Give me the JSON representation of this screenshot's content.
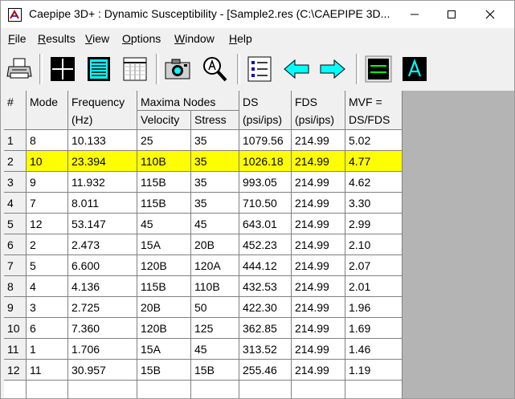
{
  "window": {
    "title": "Caepipe 3D+ : Dynamic Susceptibility -  [Sample2.res (C:\\CAEPIPE 3D..."
  },
  "menu": [
    {
      "u": "F",
      "rest": "ile"
    },
    {
      "u": "R",
      "rest": "esults"
    },
    {
      "u": "V",
      "rest": "iew"
    },
    {
      "u": "O",
      "rest": "ptions"
    },
    {
      "u": "W",
      "rest": "indow"
    },
    {
      "u": "H",
      "rest": "elp"
    }
  ],
  "colors": {
    "highlight": "#ffff00",
    "toolbar_blue": "#00ffff",
    "toolbar_dark": "#000000"
  },
  "table": {
    "header": {
      "index": "#",
      "mode": "Mode",
      "frequency_line1": "Frequency",
      "frequency_line2": "(Hz)",
      "maxima_nodes": "Maxima Nodes",
      "velocity": "Velocity",
      "stress": "Stress",
      "ds_line1": "DS",
      "ds_line2": "(psi/ips)",
      "fds_line1": "FDS",
      "fds_line2": "(psi/ips)",
      "mvf_line1": "MVF =",
      "mvf_line2": "DS/FDS"
    },
    "rows": [
      {
        "idx": "1",
        "mode": "8",
        "freq": "10.133",
        "vel": "25",
        "stress": "35",
        "ds": "1079.56",
        "fds": "214.99",
        "mvf": "5.02"
      },
      {
        "idx": "2",
        "mode": "10",
        "freq": "23.394",
        "vel": "110B",
        "stress": "35",
        "ds": "1026.18",
        "fds": "214.99",
        "mvf": "4.77"
      },
      {
        "idx": "3",
        "mode": "9",
        "freq": "11.932",
        "vel": "115B",
        "stress": "35",
        "ds": "993.05",
        "fds": "214.99",
        "mvf": "4.62"
      },
      {
        "idx": "4",
        "mode": "7",
        "freq": "8.011",
        "vel": "115B",
        "stress": "35",
        "ds": "710.50",
        "fds": "214.99",
        "mvf": "3.30"
      },
      {
        "idx": "5",
        "mode": "12",
        "freq": "53.147",
        "vel": "45",
        "stress": "45",
        "ds": "643.01",
        "fds": "214.99",
        "mvf": "2.99"
      },
      {
        "idx": "6",
        "mode": "2",
        "freq": "2.473",
        "vel": "15A",
        "stress": "20B",
        "ds": "452.23",
        "fds": "214.99",
        "mvf": "2.10"
      },
      {
        "idx": "7",
        "mode": "5",
        "freq": "6.600",
        "vel": "120B",
        "stress": "120A",
        "ds": "444.12",
        "fds": "214.99",
        "mvf": "2.07"
      },
      {
        "idx": "8",
        "mode": "4",
        "freq": "4.136",
        "vel": "115B",
        "stress": "110B",
        "ds": "432.53",
        "fds": "214.99",
        "mvf": "2.01"
      },
      {
        "idx": "9",
        "mode": "3",
        "freq": "2.725",
        "vel": "20B",
        "stress": "50",
        "ds": "422.30",
        "fds": "214.99",
        "mvf": "1.96"
      },
      {
        "idx": "10",
        "mode": "6",
        "freq": "7.360",
        "vel": "120B",
        "stress": "125",
        "ds": "362.85",
        "fds": "214.99",
        "mvf": "1.69"
      },
      {
        "idx": "11",
        "mode": "1",
        "freq": "1.706",
        "vel": "15A",
        "stress": "45",
        "ds": "313.52",
        "fds": "214.99",
        "mvf": "1.46"
      },
      {
        "idx": "12",
        "mode": "11",
        "freq": "30.957",
        "vel": "15B",
        "stress": "15B",
        "ds": "255.46",
        "fds": "214.99",
        "mvf": "1.19"
      }
    ],
    "selected_row": 2
  }
}
